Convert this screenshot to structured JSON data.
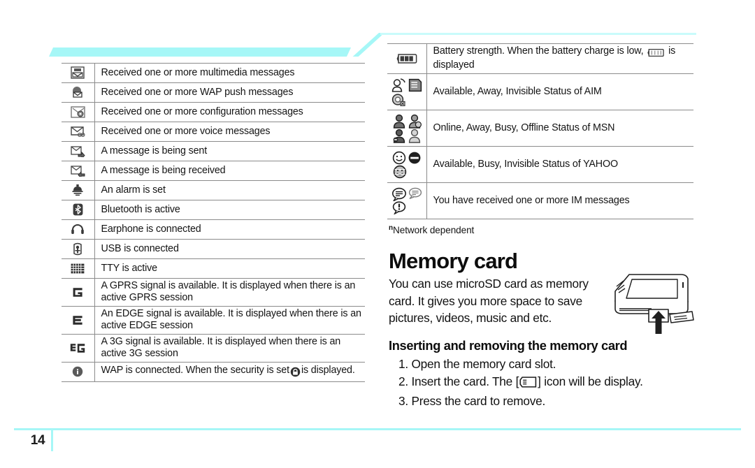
{
  "page": {
    "number": "14",
    "accent_color": "#a6f7f7",
    "text_color": "#141414",
    "rule_color": "#8b8b8b"
  },
  "left_table": {
    "name": "status-icon-table-left",
    "rows": [
      {
        "icon": "mms-envelope-icon",
        "text": "Received one or more multimedia messages"
      },
      {
        "icon": "wap-push-message-icon",
        "text": "Received one or more WAP push messages"
      },
      {
        "icon": "configuration-message-icon",
        "text": "Received one or more configuration messages"
      },
      {
        "icon": "voice-message-icon",
        "text": "Received one or more voice messages"
      },
      {
        "icon": "message-sending-icon",
        "text": "A message is being sent"
      },
      {
        "icon": "message-receiving-icon",
        "text": "A message is being received"
      },
      {
        "icon": "alarm-icon",
        "text": "An alarm is set"
      },
      {
        "icon": "bluetooth-icon",
        "text": "Bluetooth is active"
      },
      {
        "icon": "earphone-icon",
        "text": "Earphone is connected"
      },
      {
        "icon": "usb-icon",
        "text": "USB is connected"
      },
      {
        "icon": "tty-icon",
        "text": "TTY is active"
      },
      {
        "icon": "gprs-icon",
        "text": "A GPRS signal is available. It is displayed when there is an active GPRS session"
      },
      {
        "icon": "edge-icon",
        "text": "An EDGE signal is available. It is displayed when there is an active EDGE session"
      },
      {
        "icon": "three-g-icon",
        "text": "A 3G signal is available. It is displayed when there is an active 3G session"
      },
      {
        "icon": "wap-connected-icon",
        "text_before": "WAP is connected. When the security is set",
        "inline_icon": "wap-lock-icon",
        "text_after": "is displayed."
      }
    ]
  },
  "right_table": {
    "name": "status-icon-table-right",
    "rows": [
      {
        "icon": "battery-icon",
        "text_before": "Battery strength. When the battery charge is low,",
        "inline_icon": "battery-low-icon",
        "text_after": "is displayed"
      },
      {
        "icon": "aim-status-icons",
        "text": "Available, Away, Invisible Status of AIM"
      },
      {
        "icon": "msn-status-icons",
        "text": "Online, Away, Busy, Offline Status of MSN"
      },
      {
        "icon": "yahoo-status-icons",
        "text": "Available, Busy, Invisible Status of YAHOO"
      },
      {
        "icon": "im-message-icons",
        "text": "You have received one or more IM messages"
      }
    ]
  },
  "footnote": {
    "marker": "n",
    "text": "Network dependent"
  },
  "memory_card": {
    "heading": "Memory card",
    "body": "You can use microSD card as memory card. It gives you more space to save pictures, videos, music and etc.",
    "subheading": "Inserting and removing the memory card",
    "steps": [
      {
        "num": "1.",
        "text": "Open the memory card slot."
      },
      {
        "num": "2.",
        "text_before": "Insert the card. The [",
        "inline_icon": "memory-card-icon",
        "text_after": "] icon will be display."
      },
      {
        "num": "3.",
        "text": "Press the card to remove."
      }
    ],
    "illustration": "phone-memory-card-insert-illustration"
  }
}
